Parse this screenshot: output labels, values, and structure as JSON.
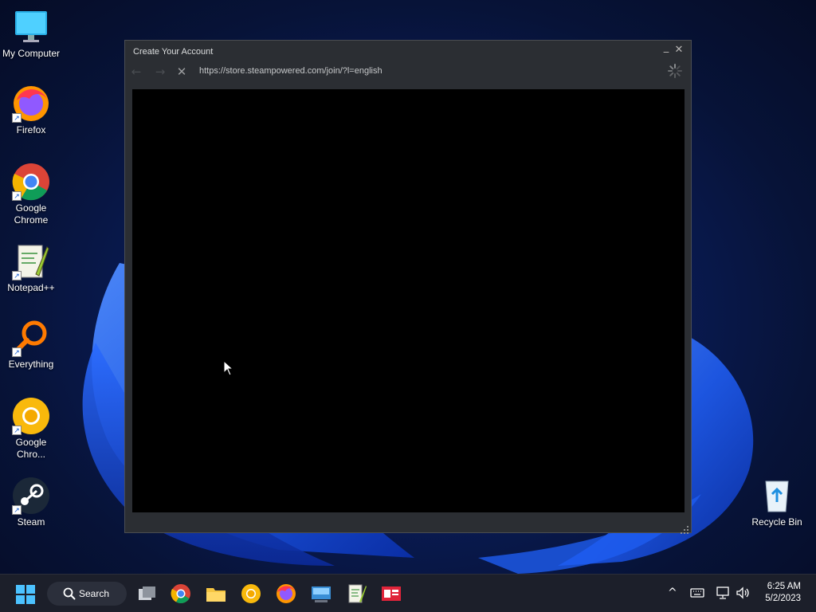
{
  "desktop": {
    "icons": [
      {
        "label": "My Computer"
      },
      {
        "label": "Firefox"
      },
      {
        "label": "Google Chrome"
      },
      {
        "label": "Notepad++"
      },
      {
        "label": "Everything"
      },
      {
        "label": "Google Chro..."
      },
      {
        "label": "Steam"
      },
      {
        "label": "Recycle Bin"
      }
    ]
  },
  "window": {
    "title": "Create Your Account",
    "url": "https://store.steampowered.com/join/?l=english",
    "minimize_glyph": "_",
    "close_glyph": "✕",
    "back_glyph": "←",
    "forward_glyph": "→",
    "stop_glyph": "✕"
  },
  "taskbar": {
    "search_label": "Search",
    "pinned": [
      "start-icon",
      "task-view-icon",
      "chrome-icon",
      "file-explorer-icon",
      "chrome-canary-icon",
      "firefox-icon",
      "keyboard-app-icon",
      "notepadpp-icon",
      "news-app-icon"
    ],
    "tray_chevron": "^",
    "time": "6:25 AM",
    "date": "5/2/2023"
  },
  "colors": {
    "window_bg": "#2b2e33",
    "content_bg": "#000000",
    "taskbar_bg": "#1c1f2a"
  }
}
